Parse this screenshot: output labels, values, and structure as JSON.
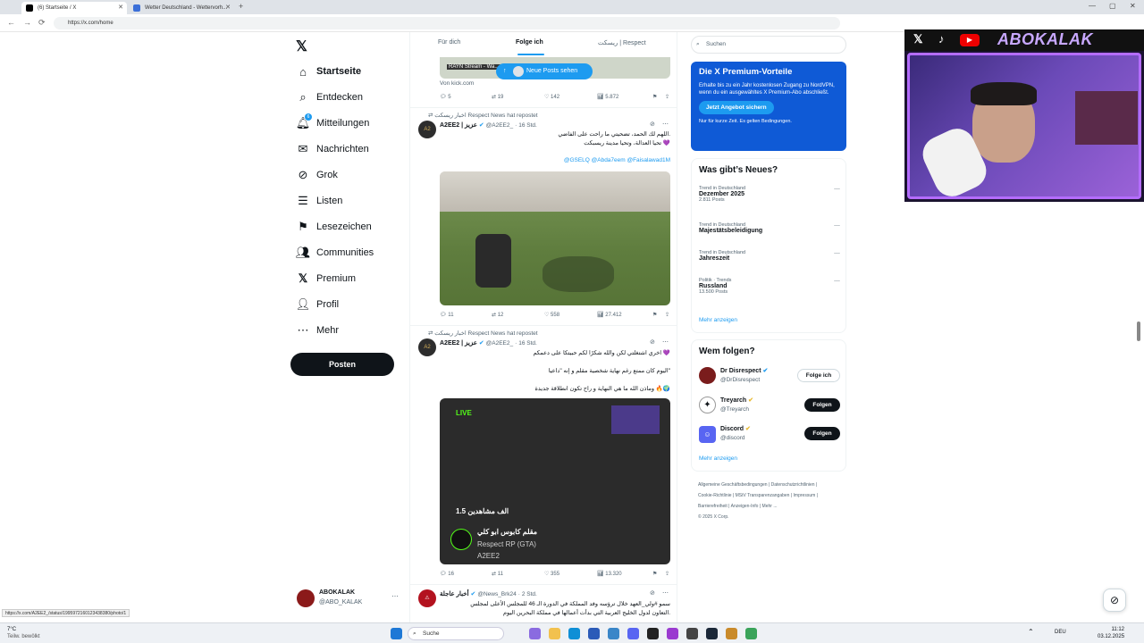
{
  "browser": {
    "tabs": [
      {
        "label": "(6) Startseite / X"
      },
      {
        "label": "Wetter Deutschland - Wettervorh..."
      }
    ],
    "url": "https://x.com/home",
    "status_url": "https://x.com/A2EE2_/status/1995972160123438380/photo/1"
  },
  "sidebar": {
    "items": [
      {
        "label": "Startseite",
        "icon": "home-icon"
      },
      {
        "label": "Entdecken",
        "icon": "search-icon"
      },
      {
        "label": "Mitteilungen",
        "icon": "bell-icon",
        "badge": "6"
      },
      {
        "label": "Nachrichten",
        "icon": "mail-icon"
      },
      {
        "label": "Grok",
        "icon": "grok-icon"
      },
      {
        "label": "Listen",
        "icon": "list-icon"
      },
      {
        "label": "Lesezeichen",
        "icon": "bookmark-icon"
      },
      {
        "label": "Communities",
        "icon": "people-icon"
      },
      {
        "label": "Premium",
        "icon": "x-icon"
      },
      {
        "label": "Profil",
        "icon": "person-icon"
      },
      {
        "label": "Mehr",
        "icon": "more-icon"
      }
    ],
    "post_label": "Posten",
    "account": {
      "name": "ABOKALAK",
      "handle": "@ABO_KALAK"
    }
  },
  "feed": {
    "tabs": [
      "Für dich",
      "Folge ich",
      "ريسكت | Respect"
    ],
    "new_posts_label": "Neue Posts sehen",
    "card_source": "Von kick.com",
    "stream_title": "RAYN Stream - Wa...",
    "top_actions": {
      "replies": "5",
      "reposts": "19",
      "likes": "142",
      "views": "5.872"
    },
    "tweets": [
      {
        "repost_line": "اخبار ريسكت Respect News hat repostet",
        "name": "A2EE2 | عزيز",
        "handle": "@A2EE2_",
        "time": "16 Std.",
        "lines": [
          "اللهم لك الحمد، تضحيتي ما راحت على الفاضي.",
          "تحيا العدالة، وتحيا مدينة ريسبكت 💜"
        ],
        "mentions": "@GSELQ @Abda7eem @Faisalawad1M",
        "actions": {
          "replies": "11",
          "reposts": "12",
          "likes": "558",
          "views": "27.412"
        }
      },
      {
        "repost_line": "اخبار ريسكت Respect News hat repostet",
        "name": "A2EE2 | عزيز",
        "handle": "@A2EE2_",
        "time": "16 Std.",
        "lines": [
          "اليوم كان ممتع رغم نهاية شخصية مقلم و إنه \"داعيا\"",
          "وماذن الله ما هي النهاية و راح تكون انطلاقة جديدة 🔥🌍",
          "اخري اشتغلتي لكن والله شكرًا لكم حبيتكا على دعمكم 💜"
        ],
        "live_label": "LIVE",
        "viewers": "1.5 الف مشاهدين",
        "stream_name": "مقلم كابوس ابو كلي",
        "stream_sub": "Respect RP (GTA)",
        "stream_handle": "A2EE2",
        "actions": {
          "replies": "16",
          "reposts": "11",
          "likes": "355",
          "views": "13.320"
        }
      },
      {
        "name": "أخبار عاجلة",
        "handle": "@News_Brk24",
        "time": "2 Std.",
        "lines": [
          "سمو #ولي_العهد خلال ترؤسه وفد المملكة في الدورة الـ 46 للمجلس الأعلى لمجلس",
          "التعاون لدول الخليج العربية التي بدأت أعمالها في مملكة البحرين اليوم."
        ]
      }
    ]
  },
  "right": {
    "search_placeholder": "Suchen",
    "premium": {
      "title": "Die X Premium-Vorteile",
      "body": "Erhalte bis zu ein Jahr kostenlosen Zugang zu NordVPN, wenn du ein ausgewähltes X Premium-Abo abschließt.",
      "button": "Jetzt Angebot sichern",
      "note": "Nur für kurze Zeit. Es gelten Bedingungen."
    },
    "trends_title": "Was gibt’s Neues?",
    "trends": [
      {
        "ctx": "Trend in Deutschland",
        "title": "Dezember 2025",
        "posts": "2.811 Posts"
      },
      {
        "ctx": "Trend in Deutschland",
        "title": "Majestätsbeleidigung",
        "posts": ""
      },
      {
        "ctx": "Trend in Deutschland",
        "title": "Jahreszeit",
        "posts": ""
      },
      {
        "ctx": "Politik · Trends",
        "title": "Russland",
        "posts": "13.500 Posts"
      }
    ],
    "show_more": "Mehr anzeigen",
    "follow_title": "Wem folgen?",
    "follow": [
      {
        "name": "Dr Disrespect",
        "handle": "@DrDisrespect",
        "button": "Folge ich"
      },
      {
        "name": "Treyarch",
        "handle": "@Treyarch",
        "button": "Folgen"
      },
      {
        "name": "Discord",
        "handle": "@discord",
        "button": "Folgen"
      }
    ],
    "follow_more": "Mehr anzeigen",
    "footer": [
      "Allgemeine Geschäftsbedingungen",
      "Datenschutzrichtlinien",
      "Cookie-Richtlinie",
      "MStV Transparenzangaben",
      "Impressum",
      "Barrierefreiheit",
      "Anzeigen-Info",
      "Mehr ...",
      "© 2025 X Corp."
    ]
  },
  "overlay": {
    "brand": "ABOKALAK"
  },
  "taskbar": {
    "weather": "7°C",
    "weather_sub": "Teilw. bewölkt",
    "search": "Suche",
    "lang": "DEU",
    "time": "11:12",
    "date": "03.12.2025"
  },
  "colors": {
    "accent": "#1d9bf0",
    "premium_bg": "#0f5ad6",
    "text": "#0f1419",
    "muted": "#536471"
  }
}
